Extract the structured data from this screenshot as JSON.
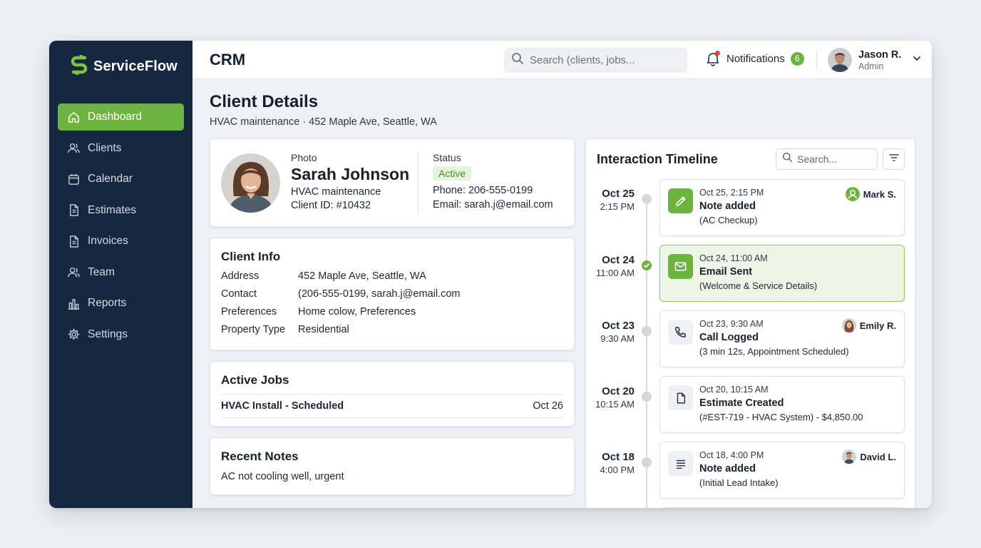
{
  "brand": {
    "name": "ServiceFlow",
    "accent": "#6cb33f",
    "sidebar_bg": "#162740"
  },
  "sidebar": {
    "items": [
      {
        "label": "Dashboard",
        "icon": "home-icon",
        "active": true
      },
      {
        "label": "Clients",
        "icon": "users-icon"
      },
      {
        "label": "Calendar",
        "icon": "calendar-icon"
      },
      {
        "label": "Estimates",
        "icon": "document-icon"
      },
      {
        "label": "Invoices",
        "icon": "document-icon"
      },
      {
        "label": "Team",
        "icon": "team-icon"
      },
      {
        "label": "Reports",
        "icon": "bar-chart-icon"
      },
      {
        "label": "Settings",
        "icon": "gear-icon"
      }
    ]
  },
  "topbar": {
    "title": "CRM",
    "search_placeholder": "Search (clients, jobs...",
    "notifications_label": "Notifications",
    "notifications_count": "6",
    "user_name": "Jason R.",
    "user_role": "Admin"
  },
  "page": {
    "title": "Client Details",
    "subtitle": "HVAC maintenance · 452 Maple Ave, Seattle, WA"
  },
  "profile": {
    "photo_label": "Photo",
    "name": "Sarah Johnson",
    "service": "HVAC maintenance",
    "client_id": "Client ID: #10432",
    "status_label": "Status",
    "status": "Active",
    "phone": "Phone: 206-555-0199",
    "email": "Email: sarah.j@email.com"
  },
  "client_info": {
    "title": "Client Info",
    "rows": [
      {
        "key": "Address",
        "value": "452 Maple Ave, Seattle, WA"
      },
      {
        "key": "Contact",
        "value": "(206-555-0199, sarah.j@email.com"
      },
      {
        "key": "Preferences",
        "value": "Home colow, Preferences"
      },
      {
        "key": "Property Type",
        "value": "Residential"
      }
    ]
  },
  "active_jobs": {
    "title": "Active Jobs",
    "jobs": [
      {
        "title": "HVAC Install - Scheduled",
        "date": "Oct 26"
      }
    ]
  },
  "recent_notes": {
    "title": "Recent Notes",
    "text": "AC not cooling well, urgent"
  },
  "timeline": {
    "title": "Interaction Timeline",
    "search_placeholder": "Search...",
    "items": [
      {
        "day": "Oct 25",
        "time": "2:15 PM",
        "when": "Oct 25, 2:15 PM",
        "head": "Note added",
        "detail": "(AC Checkup)",
        "user": "Mark S.",
        "icon": "pencil-icon",
        "state": "pending"
      },
      {
        "day": "Oct 24",
        "time": "11:00 AM",
        "when": "Oct 24, 11:00 AM",
        "head": "Email Sent",
        "detail": "(Welcome & Service Details)",
        "user": "",
        "icon": "mail-icon",
        "state": "done"
      },
      {
        "day": "Oct 23",
        "time": "9:30 AM",
        "when": "Oct 23, 9:30 AM",
        "head": "Call Logged",
        "detail": "(3 min 12s, Appointment Scheduled)",
        "user": "Emily R.",
        "icon": "phone-icon",
        "state": "pending"
      },
      {
        "day": "Oct 20",
        "time": "10:15 AM",
        "when": "Oct 20, 10:15 AM",
        "head": "Estimate Created",
        "detail": "(#EST-719 - HVAC System) - $4,850.00",
        "user": "",
        "icon": "file-icon",
        "state": "pending"
      },
      {
        "day": "Oct 18",
        "time": "4:00 PM",
        "when": "Oct 18, 4:00 PM",
        "head": "Note added",
        "detail": "(Initial Lead Intake)",
        "user": "David L.",
        "icon": "notes-icon",
        "state": "pending"
      }
    ]
  }
}
